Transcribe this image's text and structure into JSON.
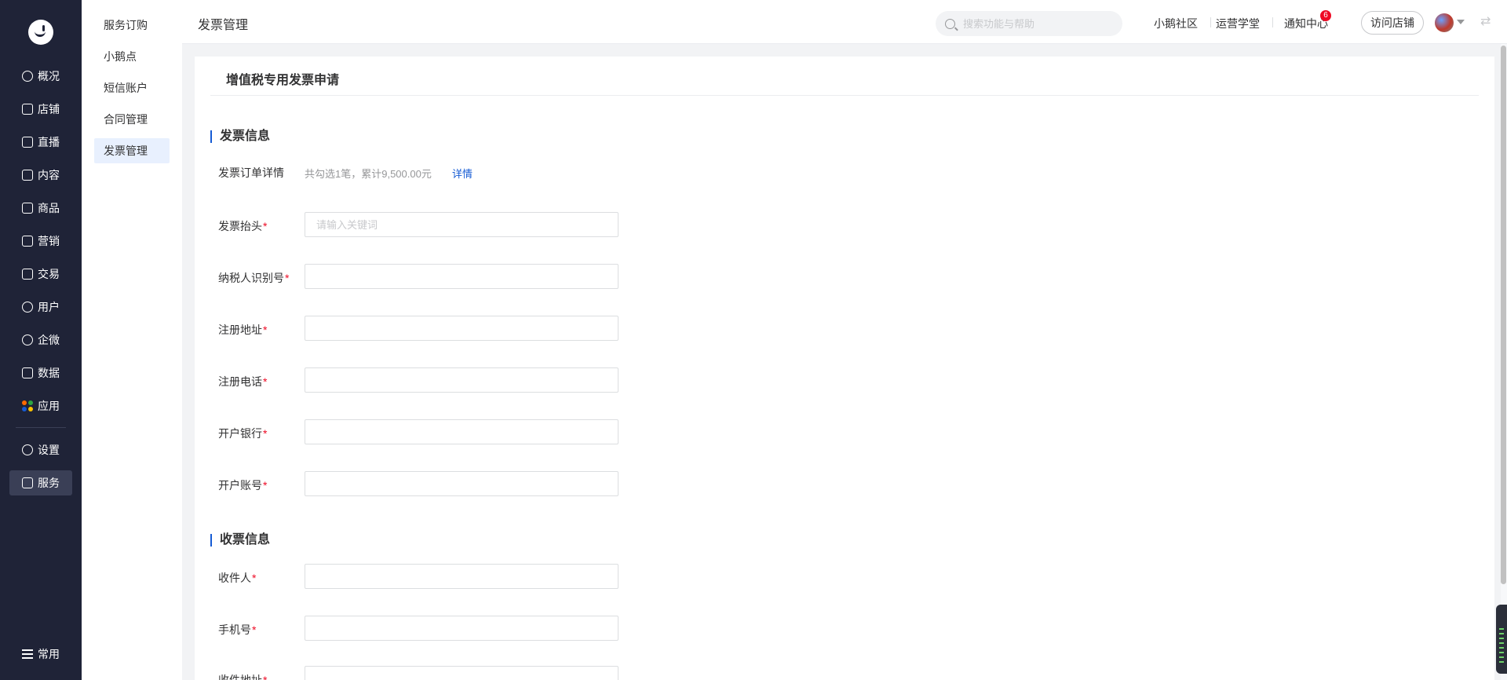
{
  "nav": {
    "items": [
      {
        "label": "概况",
        "icon": "pie-chart-icon"
      },
      {
        "label": "店铺",
        "icon": "store-icon"
      },
      {
        "label": "直播",
        "icon": "live-icon"
      },
      {
        "label": "内容",
        "icon": "document-icon"
      },
      {
        "label": "商品",
        "icon": "product-icon"
      },
      {
        "label": "营销",
        "icon": "megaphone-icon"
      },
      {
        "label": "交易",
        "icon": "trade-icon"
      },
      {
        "label": "用户",
        "icon": "user-icon"
      },
      {
        "label": "企微",
        "icon": "wecom-icon"
      },
      {
        "label": "数据",
        "icon": "data-icon"
      },
      {
        "label": "应用",
        "icon": "apps-icon"
      },
      {
        "label": "设置",
        "icon": "gear-icon"
      },
      {
        "label": "服务",
        "icon": "service-icon"
      },
      {
        "label": "常用",
        "icon": "list-icon"
      }
    ],
    "active_label": "服务"
  },
  "subnav": {
    "items": [
      "服务订购",
      "小鹅点",
      "短信账户",
      "合同管理",
      "发票管理"
    ],
    "active": "发票管理"
  },
  "header": {
    "title": "发票管理",
    "search_placeholder": "搜索功能与帮助",
    "links": [
      "小鹅社区",
      "运营学堂",
      "通知中心"
    ],
    "notification_count": "6",
    "visit_store": "访问店铺"
  },
  "card": {
    "title": "增值税专用发票申请",
    "invoice_section": "发票信息",
    "order_detail_label": "发票订单详情",
    "order_detail_info": "共勾选1笔，累计9,500.00元",
    "order_detail_link": "详情",
    "fields": [
      {
        "label": "发票抬头",
        "required": "*",
        "placeholder": "请输入关键词",
        "value": ""
      },
      {
        "label": "纳税人识别号",
        "required": "*",
        "placeholder": "",
        "value": ""
      },
      {
        "label": "注册地址",
        "required": "*",
        "placeholder": "",
        "value": ""
      },
      {
        "label": "注册电话",
        "required": "*",
        "placeholder": "",
        "value": ""
      },
      {
        "label": "开户银行",
        "required": "*",
        "placeholder": "",
        "value": ""
      },
      {
        "label": "开户账号",
        "required": "*",
        "placeholder": "",
        "value": ""
      }
    ],
    "receive_section": "收票信息",
    "receive_fields": [
      {
        "label": "收件人",
        "required": "*",
        "placeholder": "",
        "value": ""
      },
      {
        "label": "手机号",
        "required": "*",
        "placeholder": "",
        "value": ""
      },
      {
        "label": "收件地址",
        "required": "*",
        "placeholder": "",
        "value": ""
      }
    ]
  },
  "colors": {
    "nav_bg": "#1f2337",
    "accent": "#155bd4",
    "required": "#ee0a24",
    "page_bg": "#f2f3f5"
  }
}
